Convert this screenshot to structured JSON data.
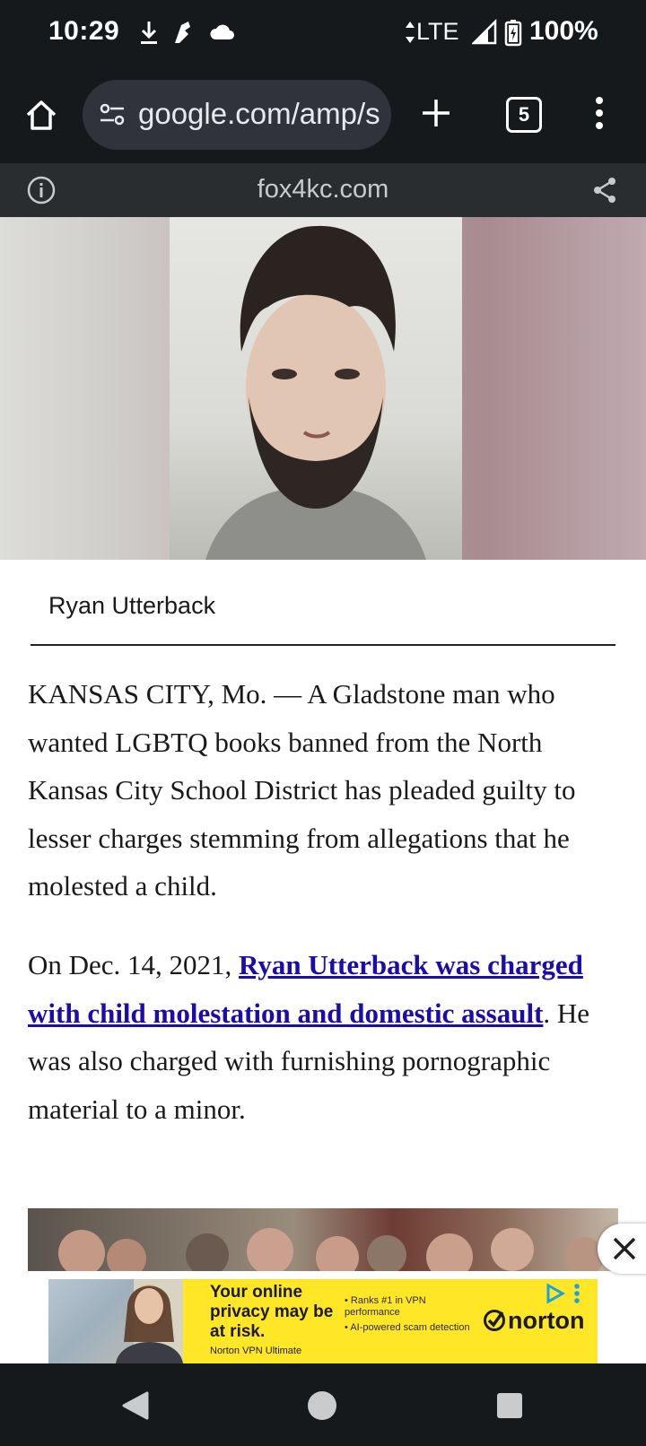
{
  "status_bar": {
    "time": "10:29",
    "network": "LTE",
    "battery": "100%",
    "icons": [
      "download-icon",
      "notification-icon",
      "cloud-icon",
      "signal-icon",
      "battery-charging-icon"
    ]
  },
  "toolbar": {
    "url": "google.com/amp/s",
    "tab_count": "5",
    "icons": [
      "home-icon",
      "site-settings-icon",
      "new-tab-icon",
      "tab-switcher-icon",
      "more-menu-icon"
    ]
  },
  "site_strip": {
    "domain": "fox4kc.com",
    "icons": [
      "info-icon",
      "share-icon"
    ]
  },
  "article": {
    "image_caption": "Ryan Utterback",
    "paragraph1": "KANSAS CITY, Mo. — A Gladstone man who wanted LGBTQ books banned from the North Kansas City School District has pleaded guilty to lesser charges stemming from allegations that he molested a child.",
    "paragraph2": {
      "before": "On Dec. 14, 2021, ",
      "link": "Ryan Utterback was charged with child molestation and domestic assault",
      "after": ". He was also charged with furnishing pornographic material to a minor."
    }
  },
  "ad": {
    "headline": "Your online privacy may be at risk.",
    "subline": "Norton VPN Ultimate",
    "bullets": [
      "Ranks #1 in VPN performance",
      "AI-powered scam detection"
    ],
    "brand": "norton"
  },
  "colors": {
    "system_bar": "#16191c",
    "omnibox": "#30333a",
    "link": "#1a0dab",
    "ad_background": "#ffe626"
  }
}
